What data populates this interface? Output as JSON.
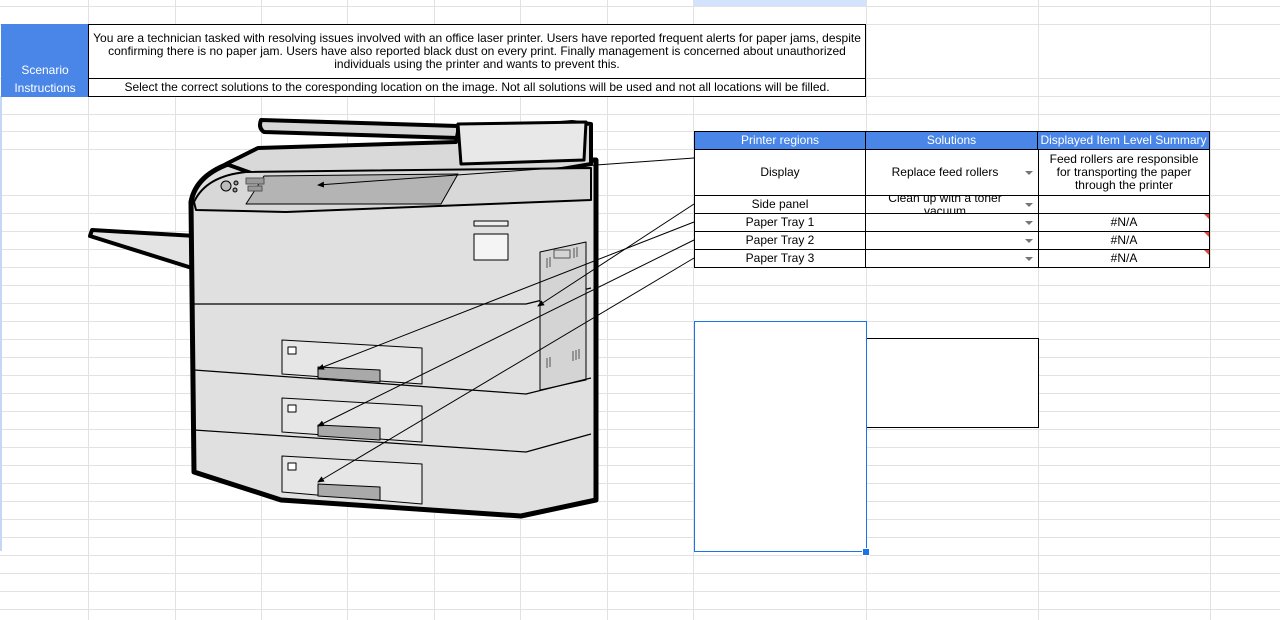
{
  "scenario": {
    "label_line1": "Scenario",
    "label_line2": "Instructions",
    "description": "You are a technician tasked with resolving issues involved with an office laser printer. Users have reported frequent alerts for paper jams, despite confirming there is no paper jam. Users have also reported black dust on every print. Finally management is concerned about unauthorized individuals using the printer and wants to prevent this.",
    "instruction": "Select the correct solutions to the coresponding location on the image. Not all solutions will be used and not all locations will be filled."
  },
  "table": {
    "headers": [
      "Printer regions",
      "Solutions",
      "Displayed Item Level Summary"
    ],
    "rows": [
      {
        "region": "Display",
        "solution": "Replace feed rollers",
        "summary": "Feed rollers are responsible for transporting the paper through the printer"
      },
      {
        "region": "Side panel",
        "solution": "Clean up with a toner vacuum",
        "summary": ""
      },
      {
        "region": "Paper Tray 1",
        "solution": "",
        "summary": "#N/A"
      },
      {
        "region": "Paper Tray 2",
        "solution": "",
        "summary": "#N/A"
      },
      {
        "region": "Paper Tray 3",
        "solution": "",
        "summary": "#N/A"
      }
    ]
  },
  "colors": {
    "header_blue": "#4a86e8",
    "selection_blue": "#1a73e8",
    "error_red": "#ea4335"
  }
}
